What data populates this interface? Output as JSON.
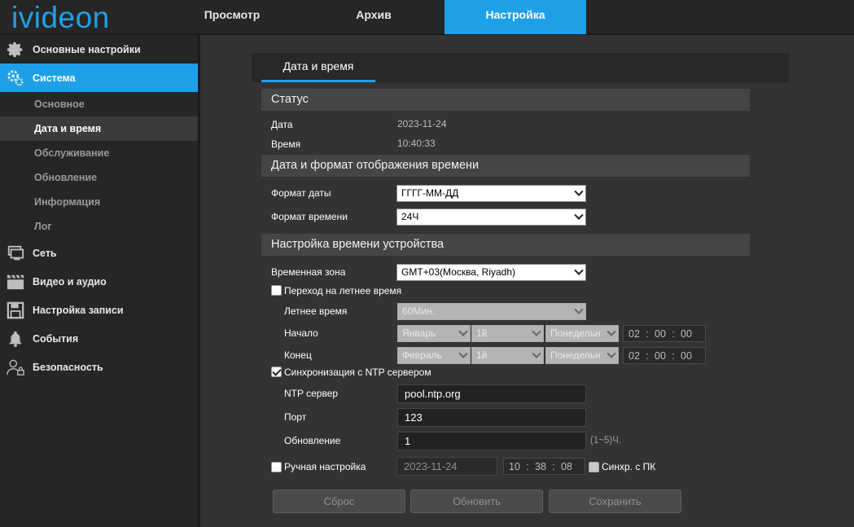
{
  "logo": "ivideon",
  "topnav": [
    {
      "label": "Просмотр"
    },
    {
      "label": "Архив"
    },
    {
      "label": "Настройка"
    }
  ],
  "sidebar": {
    "items": [
      {
        "label": "Основные настройки",
        "icon": "gear-icon"
      },
      {
        "label": "Система",
        "icon": "gears-icon"
      },
      {
        "label": "Сеть",
        "icon": "network-icon"
      },
      {
        "label": "Видео и аудио",
        "icon": "clapperboard-icon"
      },
      {
        "label": "Настройка записи",
        "icon": "floppy-icon"
      },
      {
        "label": "События",
        "icon": "bell-icon"
      },
      {
        "label": "Безопасность",
        "icon": "user-lock-icon"
      }
    ],
    "system_sub": [
      {
        "label": "Основное"
      },
      {
        "label": "Дата и время"
      },
      {
        "label": "Обслуживание"
      },
      {
        "label": "Обновление"
      },
      {
        "label": "Информация"
      },
      {
        "label": "Лог"
      }
    ]
  },
  "content_tab": "Дата и время",
  "status": {
    "title": "Статус",
    "date_label": "Дата",
    "date_value": "2023-11-24",
    "time_label": "Время",
    "time_value": "10:40:33"
  },
  "format": {
    "title": "Дата и формат отображения времени",
    "date_format_label": "Формат даты",
    "date_format_value": "ГГГГ-ММ-ДД",
    "time_format_label": "Формат времени",
    "time_format_value": "24Ч"
  },
  "device_time": {
    "title": "Настройка времени устройства",
    "timezone_label": "Временная зона",
    "timezone_value": "GMT+03(Москва, Riyadh)",
    "dst_label": "Переход на летнее время",
    "summer_time_label": "Летнее время",
    "summer_time_value": "60Мин.",
    "start_label": "Начало",
    "start_month": "Январь",
    "start_week": "1й",
    "start_day": "Понедельн",
    "start_time": {
      "h": "02",
      "m": "00",
      "s": "00"
    },
    "end_label": "Конец",
    "end_month": "Февраль",
    "end_week": "1й",
    "end_day": "Понедельн",
    "end_time": {
      "h": "02",
      "m": "00",
      "s": "00"
    },
    "ntp_label": "Синхронизация с NTP сервером",
    "ntp_server_label": "NTP сервер",
    "ntp_server_value": "pool.ntp.org",
    "port_label": "Порт",
    "port_value": "123",
    "update_label": "Обновление",
    "update_value": "1",
    "update_hint": "(1~5)Ч.",
    "manual_label": "Ручная настройка",
    "manual_date": "2023-11-24",
    "manual_time": {
      "h": "10",
      "m": "38",
      "s": "08"
    },
    "sync_pc_label": "Синхр. с ПК"
  },
  "buttons": {
    "reset": "Сброс",
    "refresh": "Обновить",
    "save": "Сохранить"
  },
  "colors": {
    "accent": "#1ea0e8",
    "background": "#333333",
    "sidebar": "#262626"
  }
}
